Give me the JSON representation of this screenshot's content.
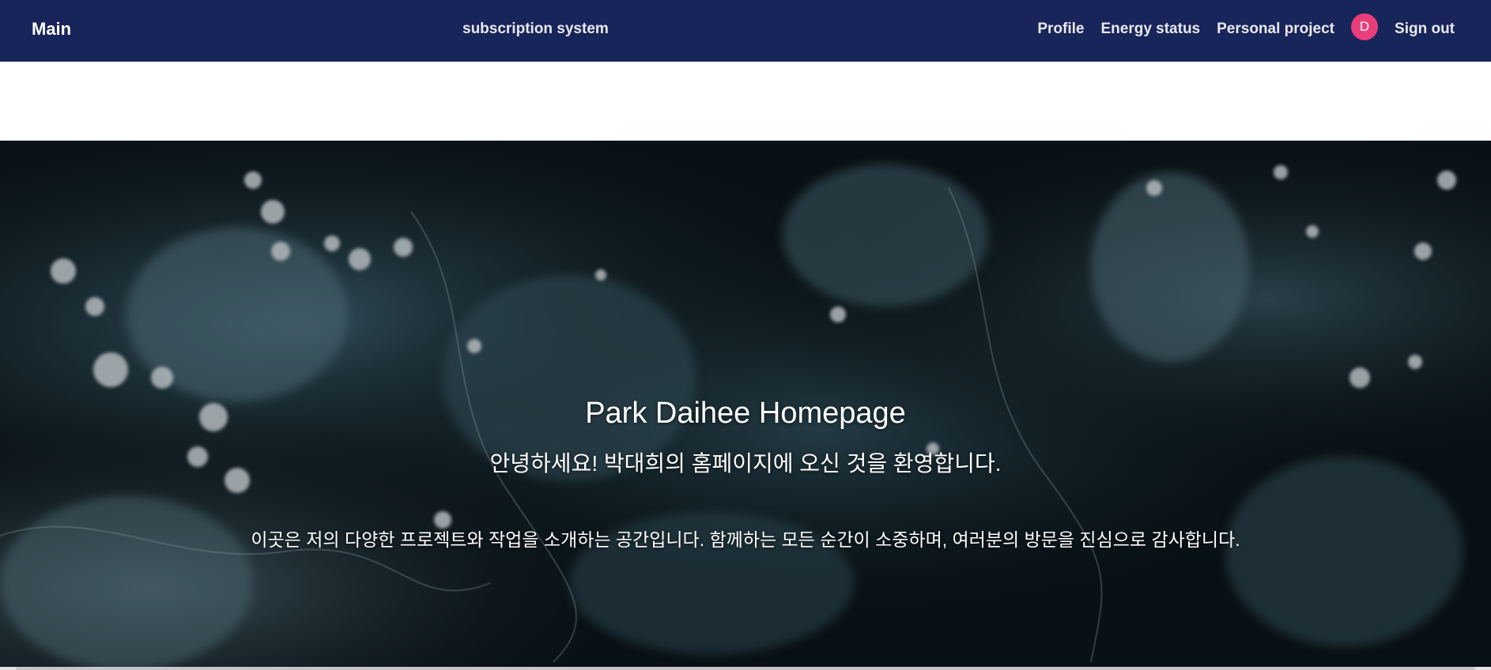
{
  "navbar": {
    "brand": "Main",
    "center_title": "subscription system",
    "links": {
      "profile": "Profile",
      "energy_status": "Energy status",
      "personal_project": "Personal project",
      "sign_out": "Sign out"
    },
    "avatar_initial": "D",
    "colors": {
      "background": "#18255a",
      "avatar": "#ea3e7a"
    }
  },
  "hero": {
    "title": "Park Daihee Homepage",
    "subtitle": "안녕하세요! 박대희의 홈페이지에 오신 것을 환영합니다.",
    "description": "이곳은 저의 다양한 프로젝트와 작업을 소개하는 공간입니다. 함께하는 모든 순간이 소중하며, 여러분의 방문을 진심으로 감사합니다.",
    "background_image": "water-splash-photo"
  }
}
